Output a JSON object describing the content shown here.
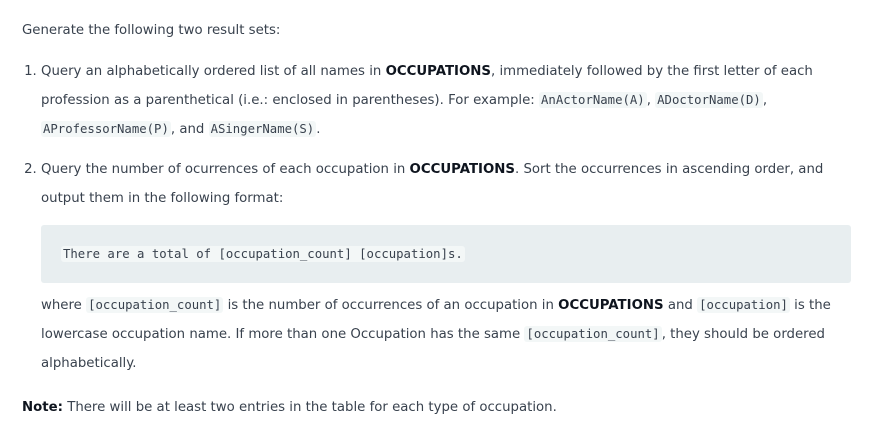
{
  "intro": "Generate the following two result sets:",
  "item1": {
    "t1": "Query an alphabetically ordered list of all names in ",
    "table": "OCCUPATIONS",
    "t2": ", immediately followed by the first letter of each profession as a parenthetical (i.e.: enclosed in parentheses). For example: ",
    "ex1": "AnActorName(A)",
    "sep1": ", ",
    "ex2": "ADoctorName(D)",
    "sep2": ", ",
    "ex3": "AProfessorName(P)",
    "sep3": ", and ",
    "ex4": "ASingerName(S)",
    "end": "."
  },
  "item2": {
    "t1": "Query the number of ocurrences of each occupation in ",
    "table": "OCCUPATIONS",
    "t2": ". Sort the occurrences in ascending order, and output them in the following format:",
    "code": "There are a total of [occupation_count] [occupation]s.",
    "w1": "where ",
    "c1": "[occupation_count]",
    "w2": " is the number of occurrences of an occupation in ",
    "table2": "OCCUPATIONS",
    "w3": " and ",
    "c2": "[occupation]",
    "w4": " is the lowercase occupation name. If more than one Occupation has the same ",
    "c3": "[occupation_count]",
    "w5": ", they should be ordered alphabetically."
  },
  "note": {
    "label": "Note:",
    "text": " There will be at least two entries in the table for each type of occupation."
  }
}
